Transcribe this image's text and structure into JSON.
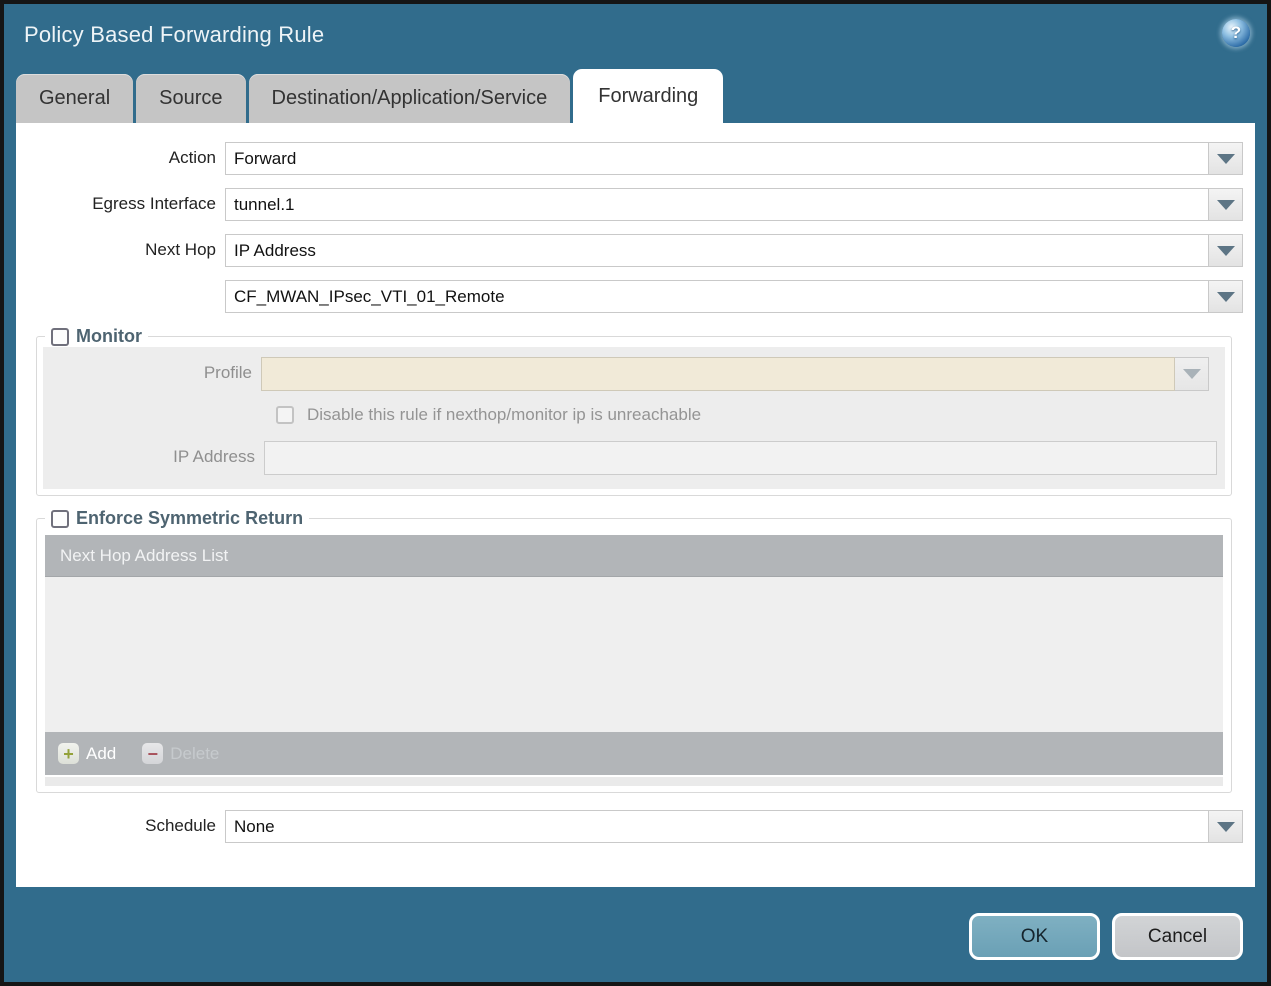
{
  "window": {
    "title": "Policy Based Forwarding Rule"
  },
  "icons": {
    "help_glyph": "?",
    "add_glyph": "+",
    "delete_glyph": "−"
  },
  "tabs": [
    {
      "label": "General",
      "active": false
    },
    {
      "label": "Source",
      "active": false
    },
    {
      "label": "Destination/Application/Service",
      "active": false
    },
    {
      "label": "Forwarding",
      "active": true
    }
  ],
  "form": {
    "action": {
      "label": "Action",
      "value": "Forward"
    },
    "egress_interface": {
      "label": "Egress Interface",
      "value": "tunnel.1"
    },
    "next_hop": {
      "label": "Next Hop",
      "value": "IP Address"
    },
    "next_hop_address": {
      "value": "CF_MWAN_IPsec_VTI_01_Remote"
    },
    "schedule": {
      "label": "Schedule",
      "value": "None"
    }
  },
  "monitor": {
    "legend": "Monitor",
    "checked": false,
    "profile": {
      "label": "Profile",
      "value": ""
    },
    "disable_rule_checkbox": {
      "label": "Disable this rule if nexthop/monitor ip is unreachable",
      "checked": false
    },
    "ip_address": {
      "label": "IP Address",
      "value": ""
    }
  },
  "enforce_symmetric_return": {
    "legend": "Enforce Symmetric Return",
    "checked": false,
    "table": {
      "header": "Next Hop Address List",
      "rows": []
    },
    "add_label": "Add",
    "delete_label": "Delete"
  },
  "footer": {
    "ok_label": "OK",
    "cancel_label": "Cancel"
  },
  "colors": {
    "chrome_teal": "#316c8c",
    "tab_inactive": "#c5c5c5",
    "panel_gray": "#ededed",
    "table_gray": "#b2b5b8",
    "profile_beige": "#f1ead8",
    "ok_button": "#6aa0b5",
    "cancel_button": "#c3c5c8",
    "legend_text": "#4e6471"
  }
}
